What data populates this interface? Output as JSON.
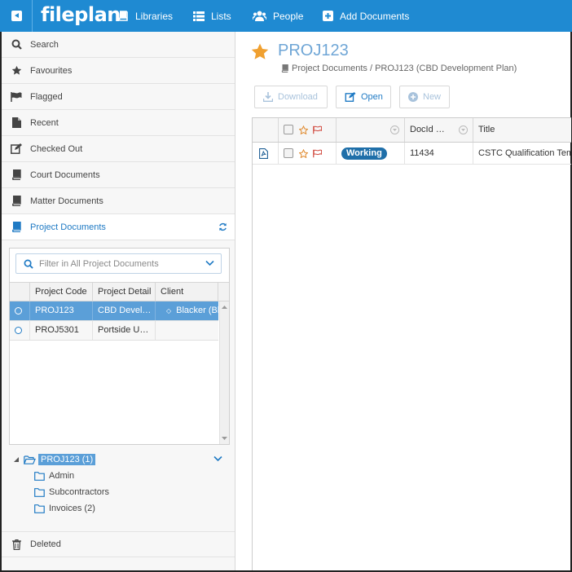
{
  "app": {
    "logo": "fileplan"
  },
  "topnav": [
    {
      "label": "Libraries",
      "icon": "book-icon"
    },
    {
      "label": "Lists",
      "icon": "list-icon"
    },
    {
      "label": "People",
      "icon": "people-icon"
    },
    {
      "label": "Add Documents",
      "icon": "plus-square-icon"
    }
  ],
  "sidebar": {
    "items": [
      {
        "label": "Search",
        "icon": "search-icon"
      },
      {
        "label": "Favourites",
        "icon": "star-icon"
      },
      {
        "label": "Flagged",
        "icon": "flag-icon"
      },
      {
        "label": "Recent",
        "icon": "file-icon"
      },
      {
        "label": "Checked Out",
        "icon": "edit-icon"
      },
      {
        "label": "Court Documents",
        "icon": "book-icon"
      },
      {
        "label": "Matter Documents",
        "icon": "book-icon"
      },
      {
        "label": "Project Documents",
        "icon": "book-icon"
      }
    ],
    "deleted_label": "Deleted"
  },
  "project_panel": {
    "filter_placeholder": "Filter in All Project Documents",
    "columns": [
      "Project Code",
      "Project Detail",
      "Client"
    ],
    "rows": [
      {
        "code": "PROJ123",
        "detail": "CBD Devel…",
        "client": "Blacker (Bl",
        "selected": true
      },
      {
        "code": "PROJ5301",
        "detail": "Portside U…",
        "client": "",
        "selected": false
      }
    ]
  },
  "tree": {
    "root": "PROJ123 (1)",
    "children": [
      "Admin",
      "Subcontractors",
      "Invoices (2)"
    ]
  },
  "main": {
    "title": "PROJ123",
    "breadcrumb": "Project Documents / PROJ123 (CBD Development Plan)",
    "toolbar": {
      "download": "Download",
      "open": "Open",
      "new": "New"
    },
    "columns": {
      "docid": "DocId …",
      "title": "Title"
    },
    "rows": [
      {
        "status": "Working",
        "docid": "11434",
        "title": "CSTC Qualification Tem"
      }
    ]
  },
  "colors": {
    "topbar": "#1f8ad2",
    "accent": "#1f7ac4",
    "selection": "#5b9fd8",
    "star": "#f0a030",
    "badge": "#1f6fa9"
  }
}
